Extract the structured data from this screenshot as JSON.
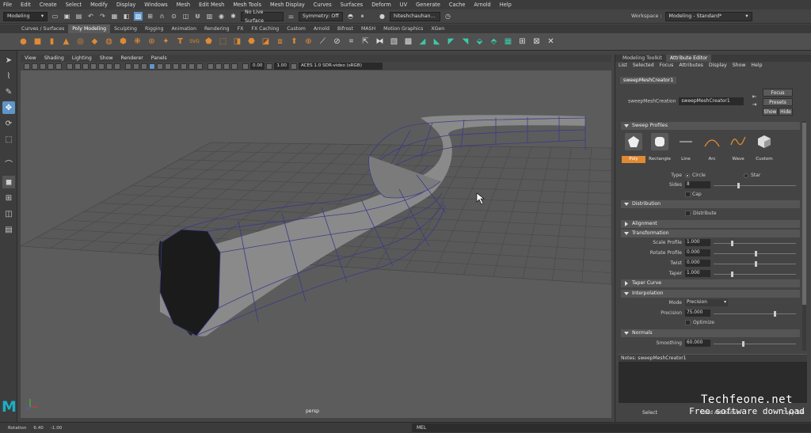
{
  "menubar": {
    "items": [
      "File",
      "Edit",
      "Create",
      "Select",
      "Modify",
      "Display",
      "Windows",
      "Mesh",
      "Edit Mesh",
      "Mesh Tools",
      "Mesh Display",
      "Curves",
      "Surfaces",
      "Deform",
      "UV",
      "Generate",
      "Cache",
      "Arnold",
      "Help"
    ]
  },
  "status": {
    "mode": "Modeling",
    "live_surface": "No Live Surface",
    "symmetry": "Symmetry: Off",
    "user": "hiteshchauhan...",
    "workspace_label": "Workspace :",
    "workspace_value": "Modeling - Standard*"
  },
  "shelf_tabs": [
    "Curves / Surfaces",
    "Poly Modeling",
    "Sculpting",
    "Rigging",
    "Animation",
    "Rendering",
    "FX",
    "FX Caching",
    "Custom",
    "Arnold",
    "Bifrost",
    "MASH",
    "Motion Graphics",
    "XGen"
  ],
  "shelf_active": "Poly Modeling",
  "viewport": {
    "menu": [
      "View",
      "Shading",
      "Lighting",
      "Show",
      "Renderer",
      "Panels"
    ],
    "field1": "0.00",
    "field2": "1.00",
    "colorspace": "ACES 1.0 SDR-video (sRGB)",
    "camera": "persp"
  },
  "panel": {
    "tabs": [
      "Modeling Toolkit",
      "Attribute Editor"
    ],
    "active_tab": "Attribute Editor",
    "menu": [
      "List",
      "Selected",
      "Focus",
      "Attributes",
      "Display",
      "Show",
      "Help"
    ],
    "node_tab": "sweepMeshCreator1",
    "node_label": "sweepMeshCreation",
    "node_value": "sweepMeshCreator1",
    "btn_focus": "Focus",
    "btn_presets": "Presets",
    "btn_show": "Show",
    "btn_hide": "Hide",
    "sections": {
      "sweep_profiles": "Sweep Profiles",
      "distribution": "Distribution",
      "alignment": "Alignment",
      "transformation": "Transformation",
      "taper_curve": "Taper Curve",
      "interpolation": "Interpolation",
      "normals": "Normals"
    },
    "profiles": [
      "Poly",
      "Rectangle",
      "Line",
      "Arc",
      "Wave",
      "Custom"
    ],
    "profile_active": "Poly",
    "type_label": "Type",
    "type_circle": "Circle",
    "type_star": "Star",
    "sides_label": "Sides",
    "sides_value": "8",
    "cap_label": "Cap",
    "distribute_label": "Distribute",
    "scale_label": "Scale Profile",
    "scale_value": "1.000",
    "rotate_label": "Rotate Profile",
    "rotate_value": "0.000",
    "twist_label": "Twist",
    "twist_value": "0.000",
    "taper_label": "Taper",
    "taper_value": "1.000",
    "mode_label": "Mode",
    "mode_value": "Precision",
    "precision_label": "Precision",
    "precision_value": "75.000",
    "optimize_label": "Optimize",
    "smoothing_label": "Smoothing",
    "smoothing_value": "60.000",
    "notes": "Notes:  sweepMeshCreator1",
    "footer": [
      "Select",
      "Load Attributes",
      "Copy Tab"
    ]
  },
  "bottom": {
    "rotation_label": "Rotation",
    "v1": "6.40",
    "v2": "-1.00",
    "mel": "MEL"
  },
  "watermark": {
    "line1": "Techfeone.net",
    "line2": "Free software download"
  }
}
